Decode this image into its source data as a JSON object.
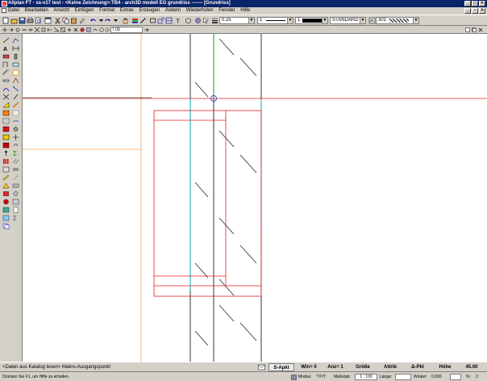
{
  "window": {
    "title": "Allplan FT - ss-v17 test - <Keine Zeichnung>:TB4 - arch3D modell EG grundriss ------- [Grundriss]"
  },
  "menu": {
    "items": [
      "Datei",
      "Bearbeiten",
      "Ansicht",
      "Einfügen",
      "Format",
      "Extras",
      "Erzeugen",
      "Ändern",
      "Wiederholen",
      "Fenster",
      "Hilfe"
    ]
  },
  "toolbar": {
    "pen_value": "0.25",
    "line_value": "1",
    "color_value": "1",
    "layer_value": "STANDARD",
    "pattern_value": "301",
    "coordinate_value": "7.08"
  },
  "status": {
    "message": "<Daten aus Katalog lesen> Makro-Ausgangspunkt",
    "active_tab": "S-Apkt",
    "win_label": "Win= 0",
    "anz_label": "Anz= 1",
    "groesse_label": "Größe",
    "attrib_label": "Attrib",
    "delta_pkt_label": "Δ-Pkt",
    "hoehe_label": "Höhe",
    "hoehe_value": "45.00"
  },
  "footer": {
    "help_text": "Drücken Sie F1, um Hilfe zu erhalten.",
    "modus_label": "Modus:",
    "modus_value": "? P/T",
    "massstab_label": "Maßstab:",
    "massstab_value": "1 : 100",
    "laenge_label": "Länge:",
    "winkel_label": "Winkel:",
    "winkel_value": "0.000",
    "percent_label": "%:",
    "percent_value": "2"
  },
  "colors": {
    "titlebar": "#0a246a",
    "chrome": "#d4d0c8",
    "wall_line": "#000000",
    "red_line": "#e02020",
    "orange_line": "#f0a060",
    "cyan_line": "#00c0e0",
    "green_line": "#00c000",
    "blue_circle": "#2020c0"
  }
}
